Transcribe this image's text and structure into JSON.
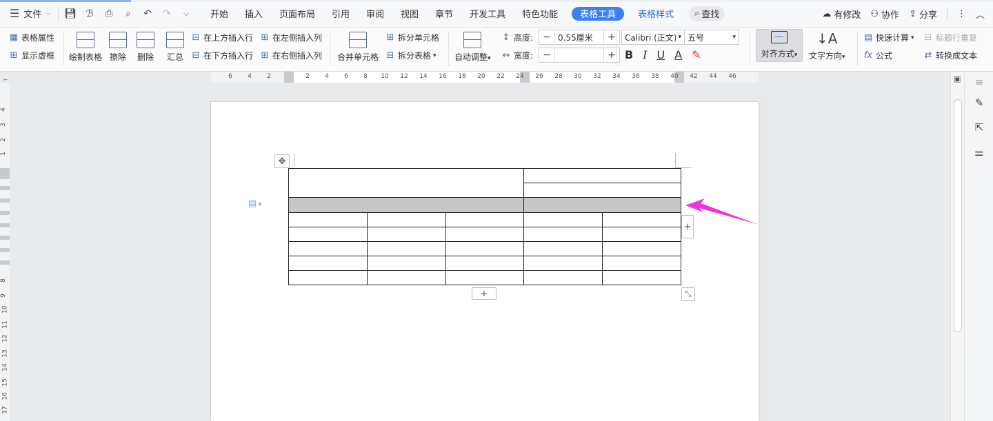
{
  "menubar": {
    "file_label": "文件",
    "tabs": [
      {
        "label": "开始"
      },
      {
        "label": "插入"
      },
      {
        "label": "页面布局"
      },
      {
        "label": "引用"
      },
      {
        "label": "审阅"
      },
      {
        "label": "视图"
      },
      {
        "label": "章节"
      },
      {
        "label": "开发工具"
      },
      {
        "label": "特色功能"
      },
      {
        "label": "表格工具"
      },
      {
        "label": "表格样式"
      }
    ],
    "search_label": "查找",
    "unsaved_label": "有修改",
    "collab_label": "协作",
    "share_label": "分享"
  },
  "ribbon": {
    "table_props": "表格属性",
    "show_grid": "显示虚框",
    "draw_table": "绘制表格",
    "erase": "擦除",
    "delete": "删除",
    "summary": "汇总",
    "insert_row_above": "在上方插入行",
    "insert_row_below": "在下方插入行",
    "insert_col_left": "在左侧插入列",
    "insert_col_right": "在右侧插入列",
    "merge_cells": "合并单元格",
    "split_cells": "拆分单元格",
    "split_table": "拆分表格",
    "auto_fit": "自动调整",
    "height_label": "高度:",
    "height_value": "0.55厘米",
    "width_label": "宽度:",
    "width_value": "",
    "font_name": "Calibri (正文)",
    "font_size": "五号",
    "bold": "B",
    "italic": "I",
    "underline": "U",
    "font_color": "A",
    "alignment": "对齐方式",
    "text_direction": "文字方向",
    "quick_calc": "快速计算",
    "formula": "公式",
    "repeat_header": "标题行重复",
    "convert_text": "转换成文本"
  },
  "ruler": {
    "h_ticks": [
      "6",
      "4",
      "2",
      "2",
      "4",
      "6",
      "8",
      "10",
      "12",
      "14",
      "16",
      "18",
      "20",
      "22",
      "24",
      "26",
      "28",
      "30",
      "32",
      "34",
      "36",
      "38",
      "40",
      "42",
      "44",
      "46"
    ],
    "v_ticks": [
      "4",
      "3",
      "2",
      "1",
      "8",
      "9",
      "10",
      "11",
      "12",
      "13",
      "14",
      "15",
      "16",
      "17"
    ]
  },
  "colors": {
    "accent": "#3c7ff2",
    "arrow": "#ee33dd",
    "shaded_row": "#c8c8c8"
  },
  "icons": {
    "move": "move-icon",
    "add_col": "plus-icon",
    "add_row": "plus-icon",
    "resize": "resize-icon",
    "paragraph": "paragraph-icon"
  }
}
